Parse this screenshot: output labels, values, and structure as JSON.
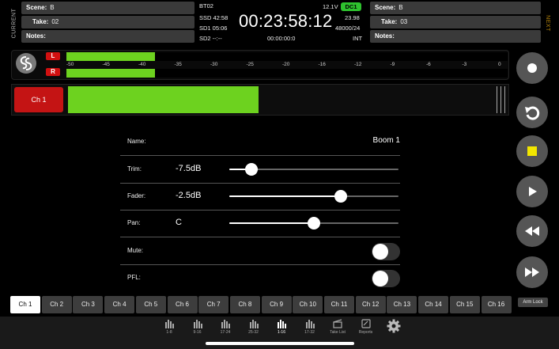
{
  "current": {
    "side_label": "CURRENT",
    "scene_label": "Scene:",
    "scene_value": "B",
    "take_label": "Take:",
    "take_value": "02",
    "notes_label": "Notes:",
    "notes_value": ""
  },
  "next": {
    "side_label": "NEXT",
    "scene_label": "Scene:",
    "scene_value": "B",
    "take_label": "Take:",
    "take_value": "03",
    "notes_label": "Notes:",
    "notes_value": ""
  },
  "status": {
    "project": "BT02",
    "ssd": "SSD 42:58",
    "sd1": "SD1 05:06",
    "sd2": "SD2 --:--",
    "voltage": "12.1V",
    "power_badge": "DC1",
    "timecode": "00:23:58:12",
    "frame_rate": "23.98",
    "sample_rate": "48000/24",
    "timecode_sub": "00:00:00:0",
    "sync": "INT"
  },
  "meters": {
    "left_label": "L",
    "right_label": "R",
    "left_level_db": -30,
    "right_level_db": -30,
    "scale": [
      "-50",
      "-45",
      "-40",
      "-35",
      "-30",
      "-25",
      "-20",
      "-16",
      "-12",
      "-9",
      "-6",
      "-3",
      "0"
    ]
  },
  "channel_meter": {
    "label": "Ch 1",
    "level_fraction": 0.43
  },
  "settings": {
    "name_label": "Name:",
    "name_value": "Boom 1",
    "trim_label": "Trim:",
    "trim_value": "-7.5dB",
    "trim_fraction": 0.13,
    "fader_label": "Fader:",
    "fader_value": "-2.5dB",
    "fader_fraction": 0.66,
    "pan_label": "Pan:",
    "pan_value": "C",
    "pan_fraction": 0.5,
    "mute_label": "Mute:",
    "mute_on": false,
    "pfl_label": "PFL:",
    "pfl_on": false
  },
  "transport": {
    "record_icon": "record-icon",
    "loop_icon": "undo-icon",
    "stop_icon": "stop-icon",
    "play_icon": "play-icon",
    "rewind_icon": "rewind-icon",
    "forward_icon": "fast-forward-icon",
    "arm_lock": "Arm Lock",
    "stop_color": "#f2e600"
  },
  "channel_tabs": [
    "Ch 1",
    "Ch 2",
    "Ch 3",
    "Ch 4",
    "Ch 5",
    "Ch 6",
    "Ch 7",
    "Ch 8",
    "Ch 9",
    "Ch 10",
    "Ch 11",
    "Ch 12",
    "Ch 13",
    "Ch 14",
    "Ch 15",
    "Ch 16"
  ],
  "active_channel": 0,
  "bottom_nav": [
    {
      "label": "1-8",
      "icon": "mixer-icon"
    },
    {
      "label": "9-16",
      "icon": "mixer-icon"
    },
    {
      "label": "17-24",
      "icon": "mixer-icon"
    },
    {
      "label": "25-32",
      "icon": "mixer-icon"
    },
    {
      "label": "1-16",
      "icon": "mixer-icon"
    },
    {
      "label": "17-32",
      "icon": "mixer-icon"
    },
    {
      "label": "Take List",
      "icon": "take-list-icon"
    },
    {
      "label": "Reports",
      "icon": "reports-icon"
    },
    {
      "label": "",
      "icon": "gear-icon"
    }
  ],
  "active_nav": 4,
  "colors": {
    "meter_green": "#6dd21f",
    "channel_red": "#c41414",
    "badge_green": "#2ec22e"
  }
}
